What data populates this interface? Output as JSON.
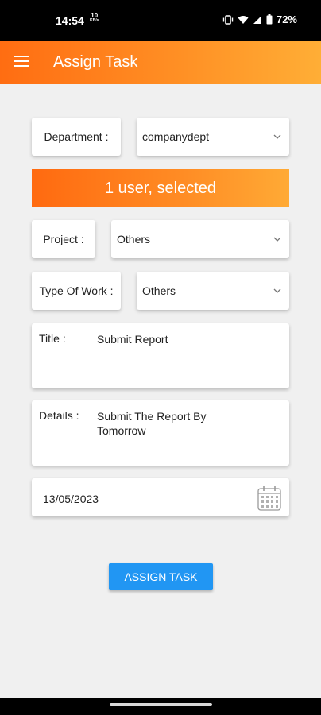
{
  "status_bar": {
    "time": "14:54",
    "net_speed_value": "10",
    "net_speed_unit": "KB/s",
    "battery": "72%"
  },
  "app_bar": {
    "title": "Assign Task",
    "menu_icon": "hamburger-menu-icon"
  },
  "form": {
    "department_label": "Department :",
    "department_value": "companydept",
    "banner_text": "1 user, selected",
    "project_label": "Project :",
    "project_value": "Others",
    "type_of_work_label": "Type Of Work :",
    "type_of_work_value": "Others",
    "title_label": "Title :",
    "title_value": "Submit Report",
    "details_label": "Details :",
    "details_value": "Submit The Report By Tomorrow",
    "date_value": "13/05/2023",
    "calendar_icon": "calendar-icon",
    "assign_button_label": "ASSIGN TASK"
  },
  "colors": {
    "accent_orange": "#ff7a18",
    "button_blue": "#2196f3",
    "background": "#f0f0f0"
  }
}
